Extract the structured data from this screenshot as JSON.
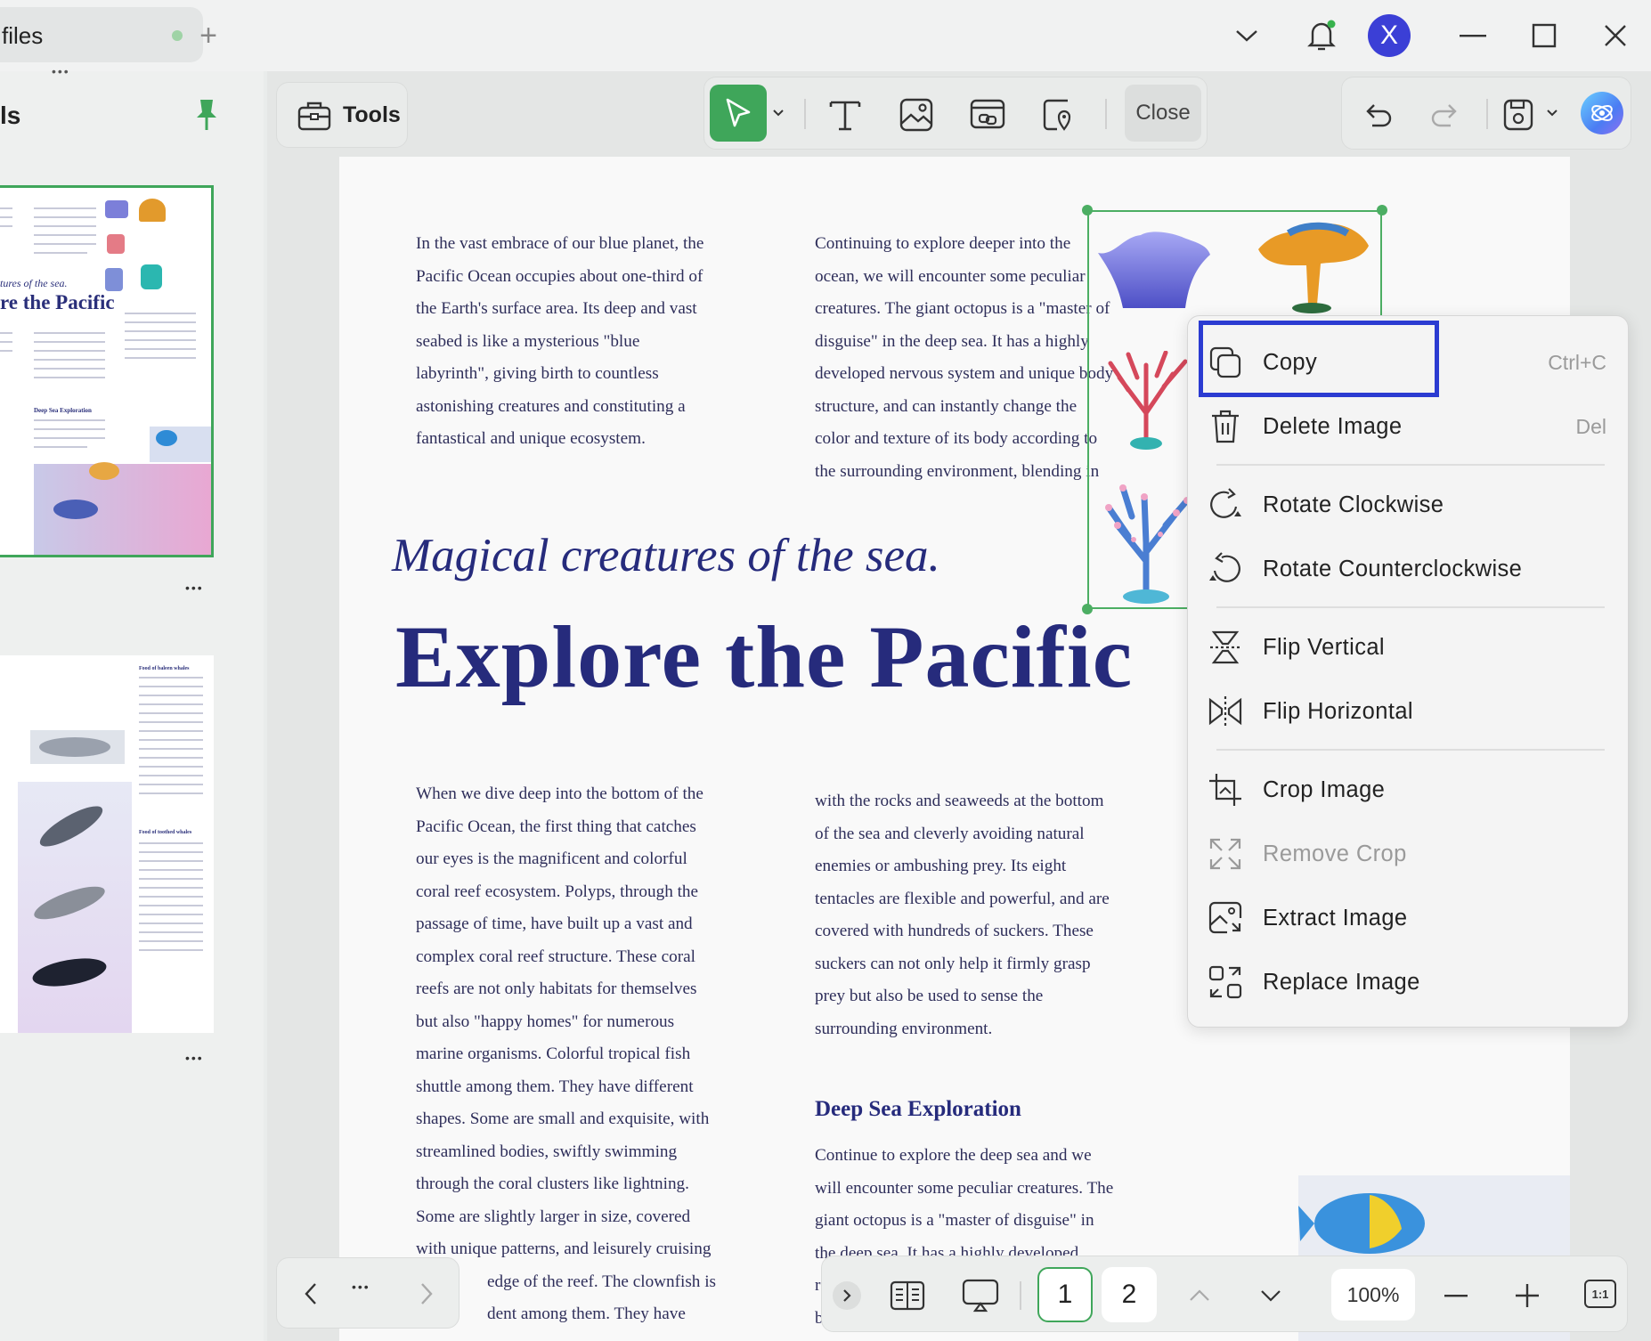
{
  "titlebar": {
    "tab_label": "files",
    "add_tab": "+",
    "avatar_letter": "X"
  },
  "sidebar": {
    "title": "ls",
    "more_dots_top": "•••",
    "more_dots_1": "•••",
    "more_dots_2": "•••",
    "thumb1_italic": "tures of the sea.",
    "thumb1_bold": "re the Pacific",
    "thumb1_heading": "Deep Sea Exploration",
    "thumb2_heading1": "Food of baleen whales",
    "thumb2_heading2": "Food of toothed whales"
  },
  "toolbar": {
    "tools_label": "Tools",
    "close_label": "Close"
  },
  "document": {
    "col1_top": [
      "In the vast embrace of our blue planet, the",
      "Pacific Ocean occupies about one-third of",
      "the Earth's surface area. Its deep and vast",
      "seabed is like a mysterious \"blue",
      "labyrinth\", giving birth to countless",
      "astonishing creatures and constituting a",
      "fantastical and unique ecosystem."
    ],
    "col2_top": [
      "Continuing to explore deeper into the",
      "ocean, we will encounter some peculiar",
      "creatures. The giant octopus is a \"master of",
      "disguise\" in the deep sea. It has a highly",
      "developed nervous system and unique body",
      "structure, and can instantly change the",
      "color and texture of its body according to",
      "the surrounding environment, blending in"
    ],
    "title_italic": "Magical creatures of the sea.",
    "title_big": "Explore the Pacific",
    "col1_bottom": [
      "When we dive deep into the bottom of the",
      "Pacific Ocean, the first thing that catches",
      "our eyes is the magnificent and colorful",
      "coral reef ecosystem. Polyps, through the",
      "passage of time, have built up a vast and",
      "complex coral reef structure. These coral",
      "reefs are not only habitats for themselves",
      "but also \"happy homes\" for numerous",
      "marine organisms. Colorful tropical fish",
      "shuttle among them. They have different",
      "shapes. Some are small and exquisite, with",
      "streamlined bodies, swiftly swimming",
      "through the coral clusters like lightning.",
      "Some are slightly larger in size, covered",
      "with unique patterns, and leisurely cruising",
      "edge of the reef. The clownfish is",
      "dent among them. They have"
    ],
    "col2_bottom": [
      "with the rocks and seaweeds at the bottom",
      "of the sea and cleverly avoiding natural",
      "enemies or ambushing prey. Its eight",
      "tentacles are flexible and powerful, and are",
      "covered with hundreds of suckers. These",
      "suckers can not only help it firmly grasp",
      "prey but also be used to sense the",
      "surrounding environment."
    ],
    "deep_heading": "Deep Sea Exploration",
    "col2_deep": [
      "Continue to explore the deep sea and we",
      "will encounter some peculiar creatures. The",
      "giant octopus is a \"master of disguise\" in",
      "the deep sea. It has a highly developed"
    ],
    "col2_cut": [
      "r",
      "b"
    ]
  },
  "context_menu": {
    "items": [
      {
        "label": "Copy",
        "shortcut": "Ctrl+C"
      },
      {
        "label": "Delete Image",
        "shortcut": "Del"
      },
      {
        "label": "Rotate Clockwise"
      },
      {
        "label": "Rotate Counterclockwise"
      },
      {
        "label": "Flip Vertical"
      },
      {
        "label": "Flip Horizontal"
      },
      {
        "label": "Crop Image"
      },
      {
        "label": "Remove Crop",
        "disabled": true
      },
      {
        "label": "Extract Image"
      },
      {
        "label": "Replace Image"
      }
    ]
  },
  "bottom_bar": {
    "more": "•••",
    "page_1": "1",
    "page_2": "2",
    "zoom": "100%",
    "actual_size": "1:1"
  },
  "colors": {
    "accent_green": "#4cae63",
    "title_navy": "#262b7c",
    "highlight_blue": "#2b3bd1",
    "avatar_blue": "#3b3fd6"
  }
}
